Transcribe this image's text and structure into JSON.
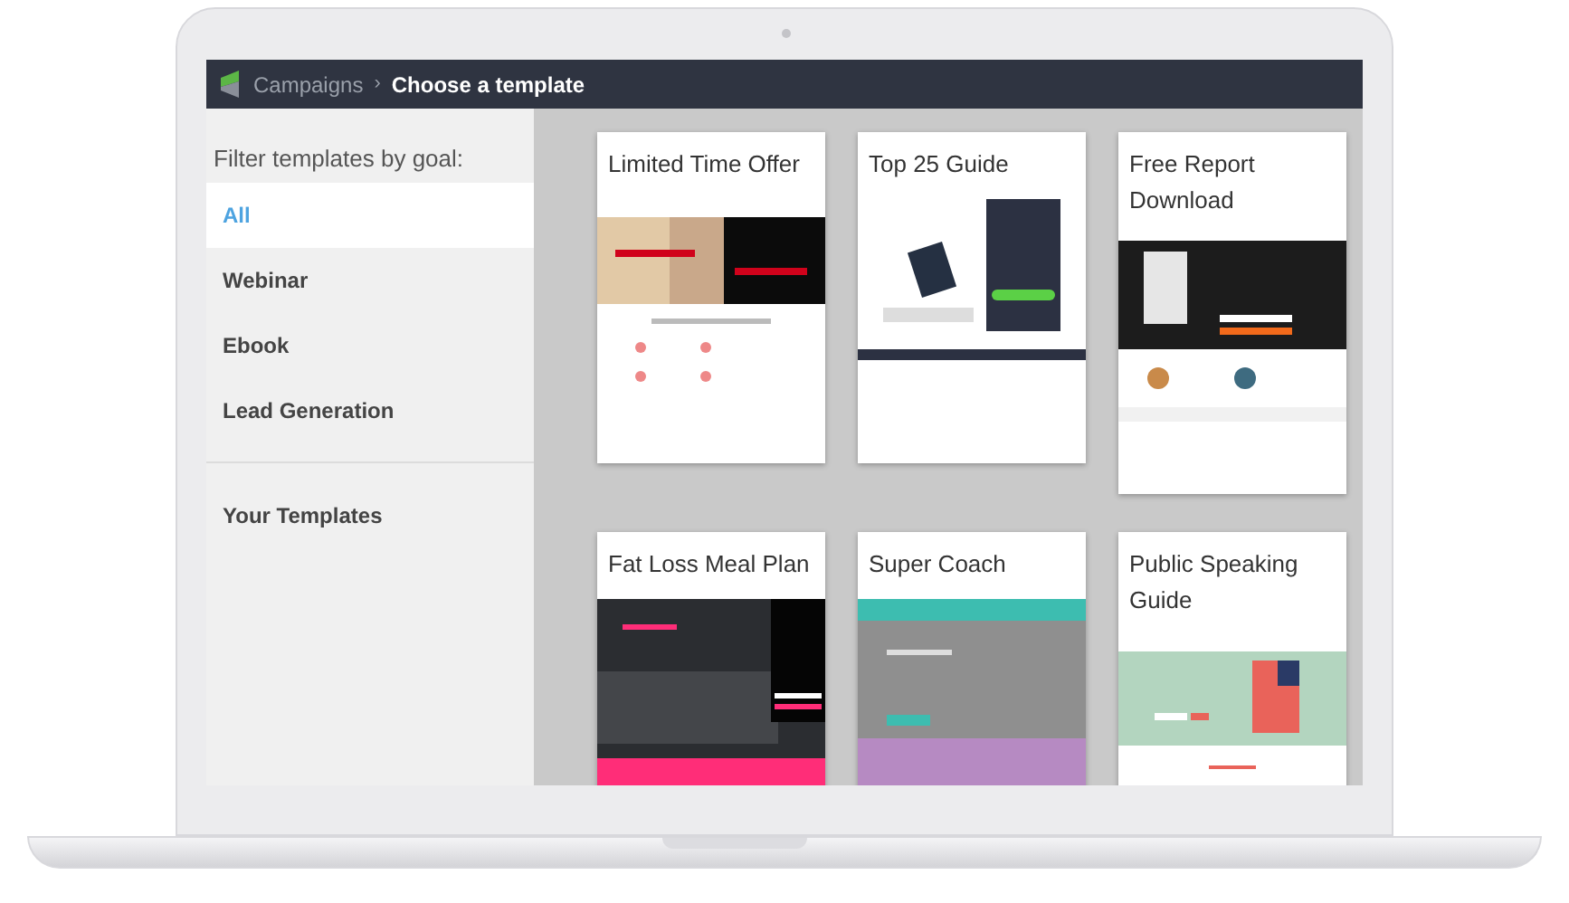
{
  "header": {
    "separator": "›",
    "breadcrumb": [
      {
        "label": "Campaigns",
        "current": false
      },
      {
        "label": "Choose a template",
        "current": true
      }
    ]
  },
  "sidebar": {
    "heading": "Filter templates by goal:",
    "goals": [
      {
        "label": "All",
        "selected": true
      },
      {
        "label": "Webinar",
        "selected": false
      },
      {
        "label": "Ebook",
        "selected": false
      },
      {
        "label": "Lead Generation",
        "selected": false
      }
    ],
    "your_templates": "Your Templates"
  },
  "templates": [
    {
      "title": "Limited Time Offer"
    },
    {
      "title": "Top 25 Guide"
    },
    {
      "title": "Free Report Download"
    },
    {
      "title": "Fat Loss Meal Plan"
    },
    {
      "title": "Super Coach"
    },
    {
      "title": "Public Speaking Guide"
    }
  ]
}
